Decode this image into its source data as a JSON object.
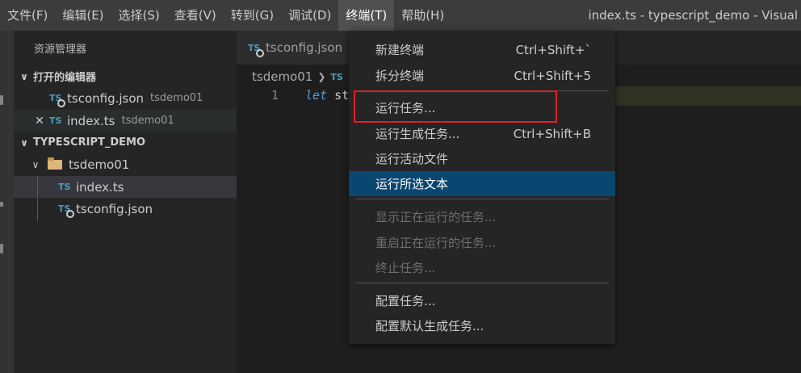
{
  "menubar": {
    "items": [
      "文件(F)",
      "编辑(E)",
      "选择(S)",
      "查看(V)",
      "转到(G)",
      "调试(D)",
      "终端(T)",
      "帮助(H)"
    ],
    "active_index": 6,
    "window_title": "index.ts - typescript_demo - Visual"
  },
  "sidebar": {
    "title": "资源管理器",
    "open_editors": {
      "header": "打开的编辑器",
      "items": [
        {
          "name": "tsconfig.json",
          "dir": "tsdemo01",
          "icon": "tsconfig-icon"
        },
        {
          "name": "index.ts",
          "dir": "tsdemo01",
          "icon": "ts-file-icon"
        }
      ]
    },
    "project": {
      "header": "TYPESCRIPT_DEMO",
      "folder": "tsdemo01",
      "files": [
        {
          "name": "index.ts",
          "icon": "ts-file-icon"
        },
        {
          "name": "tsconfig.json",
          "icon": "tsconfig-icon"
        }
      ]
    }
  },
  "editor": {
    "tab_label": "tsconfig.json",
    "tab_icon_text": "TS",
    "breadcrumb": {
      "folder": "tsdemo01",
      "sep": "❯",
      "icon_text": "TS"
    },
    "line_number": "1",
    "code_keyword": "let",
    "code_rest": "st"
  },
  "terminal_menu": {
    "items": [
      {
        "label": "新建终端",
        "shortcut": "Ctrl+Shift+`"
      },
      {
        "label": "拆分终端",
        "shortcut": "Ctrl+Shift+5"
      },
      {
        "label": "运行任务...",
        "shortcut": ""
      },
      {
        "label": "运行生成任务...",
        "shortcut": "Ctrl+Shift+B"
      },
      {
        "label": "运行活动文件",
        "shortcut": ""
      },
      {
        "label": "运行所选文本",
        "shortcut": ""
      },
      {
        "label": "显示正在运行的任务...",
        "shortcut": ""
      },
      {
        "label": "重启正在运行的任务...",
        "shortcut": ""
      },
      {
        "label": "终止任务...",
        "shortcut": ""
      },
      {
        "label": "配置任务...",
        "shortcut": ""
      },
      {
        "label": "配置默认生成任务...",
        "shortcut": ""
      }
    ]
  },
  "icons": {
    "ts_label": "TS",
    "chevron_down": "∨",
    "close": "✕"
  },
  "colors": {
    "highlight": "#094771",
    "annotation_box": "#e02020",
    "ts_icon": "#519aba",
    "keyword": "#569cd6"
  }
}
